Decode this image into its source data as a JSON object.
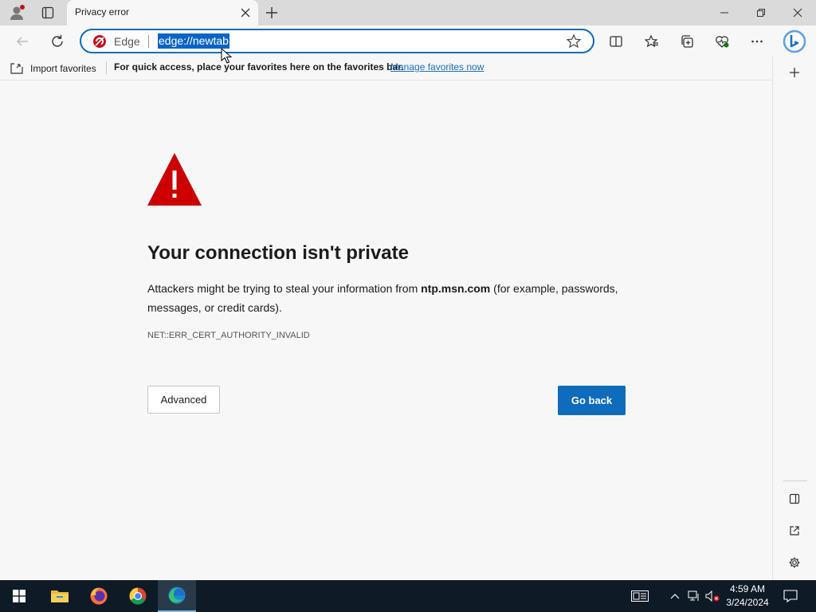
{
  "window": {
    "tab_title": "Privacy error",
    "controls": [
      "minimize",
      "restore",
      "close"
    ]
  },
  "toolbar": {
    "site_label": "Edge",
    "url": "edge://newtab"
  },
  "favorites_bar": {
    "import_label": "Import favorites",
    "hint": "For quick access, place your favorites here on the favorites bar.",
    "manage_link": "Manage favorites now"
  },
  "error_page": {
    "title": "Your connection isn't private",
    "message_before": "Attackers might be trying to steal your information from ",
    "host": "ntp.msn.com",
    "message_after": " (for example, passwords, messages, or credit cards).",
    "error_code": "NET::ERR_CERT_AUTHORITY_INVALID",
    "advanced_label": "Advanced",
    "go_back_label": "Go back"
  },
  "taskbar": {
    "apps": [
      "file-explorer",
      "firefox",
      "chrome",
      "edge"
    ],
    "active_app": "edge",
    "time": "4:59 AM",
    "date": "3/24/2024"
  },
  "colors": {
    "accent": "#0f6cbd",
    "warning": "#cc0000",
    "link": "#1a6fb5",
    "taskbar": "#0e1a26"
  }
}
